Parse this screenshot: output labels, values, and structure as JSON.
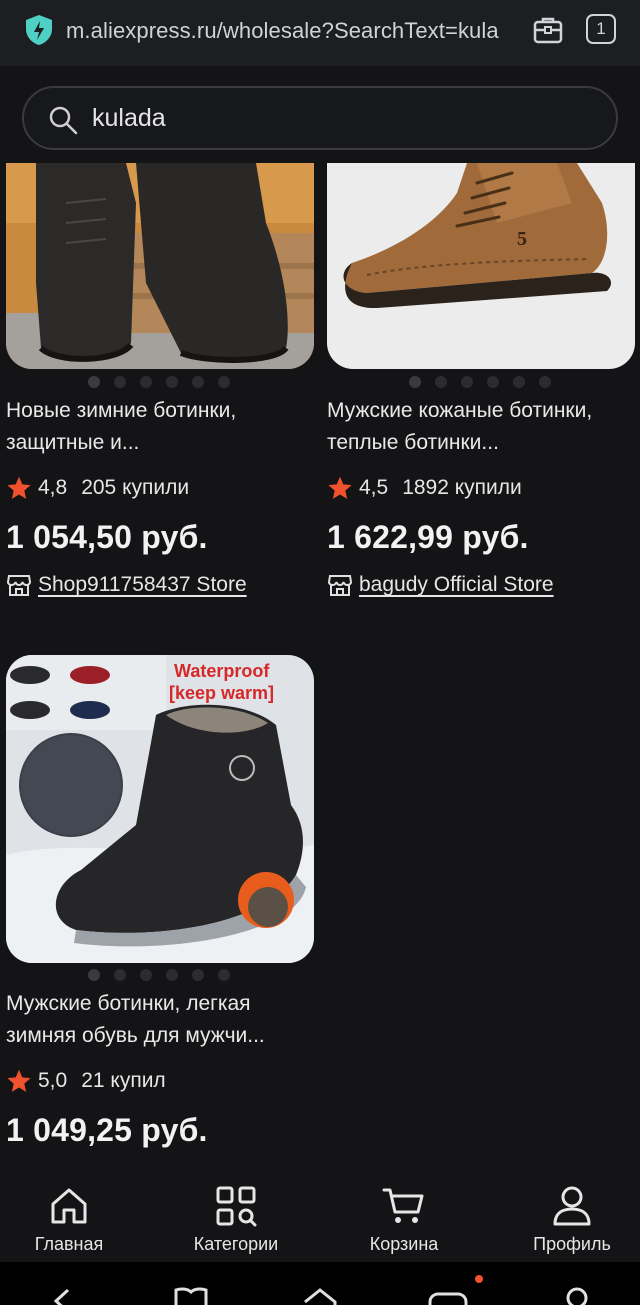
{
  "browser": {
    "url": "m.aliexpress.ru/wholesale?SearchText=kula",
    "tab_count": "1"
  },
  "search": {
    "query": "kulada"
  },
  "products": [
    {
      "title": "Новые зимние ботинки, защитные и...",
      "rating": "4,8",
      "sold": "205 купили",
      "price": "1 054,50 руб.",
      "store": "Shop911758437 Store"
    },
    {
      "title": "Мужские кожаные ботинки, теплые ботинки...",
      "rating": "4,5",
      "sold": "1892 купили",
      "price": "1 622,99 руб.",
      "store": "bagudy Official Store"
    },
    {
      "title": "Мужские ботинки, легкая зимняя обувь для мужчи...",
      "rating": "5,0",
      "sold": "21 купил",
      "price": "1 049,25 руб.",
      "image_text_1": "Waterproof",
      "image_text_2": "[keep warm]"
    }
  ],
  "nav": {
    "home": "Главная",
    "categories": "Категории",
    "cart": "Корзина",
    "profile": "Профиль"
  },
  "colors": {
    "background": "#141416",
    "star": "#f0522d",
    "shield": "#4fd0c4"
  },
  "icons": [
    "shield-icon",
    "briefcase-icon",
    "search-icon",
    "star-icon",
    "store-icon",
    "home-icon",
    "categories-icon",
    "cart-icon",
    "profile-icon"
  ]
}
